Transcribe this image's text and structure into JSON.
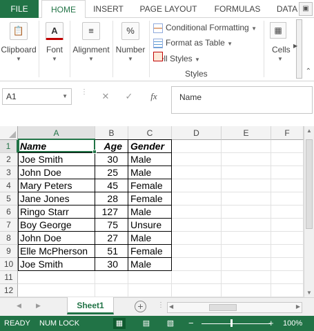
{
  "ribbon_tabs": [
    "FILE",
    "HOME",
    "INSERT",
    "PAGE LAYOUT",
    "FORMULAS",
    "DATA"
  ],
  "active_tab": "HOME",
  "ribbon": {
    "clipboard_label": "Clipboard",
    "font_label": "Font",
    "alignment_label": "Alignment",
    "number_label": "Number",
    "cells_label": "Cells",
    "styles_group_label": "Styles",
    "conditional_formatting": "Conditional Formatting",
    "format_as_table": "Format as Table",
    "cell_styles": "Cell Styles",
    "font_icon_glyph": "A",
    "number_icon_glyph": "%"
  },
  "formula_bar": {
    "name_box": "A1",
    "cancel_glyph": "✕",
    "enter_glyph": "✓",
    "fx_glyph": "fx",
    "content": "Name"
  },
  "grid": {
    "columns": [
      "A",
      "B",
      "C",
      "D",
      "E",
      "F"
    ],
    "selected_column": "A",
    "rows": [
      "1",
      "2",
      "3",
      "4",
      "5",
      "6",
      "7",
      "8",
      "9",
      "10",
      "11",
      "12"
    ],
    "selected_row": "1",
    "header": [
      "Name",
      "Age",
      "Gender"
    ],
    "data": [
      [
        "Joe Smith",
        "30",
        "Male"
      ],
      [
        "John Doe",
        "25",
        "Male"
      ],
      [
        "Mary Peters",
        "45",
        "Female"
      ],
      [
        "Jane Jones",
        "28",
        "Female"
      ],
      [
        "Ringo Starr",
        "127",
        "Male"
      ],
      [
        "Boy George",
        "75",
        "Unsure"
      ],
      [
        "John Doe",
        "27",
        "Male"
      ],
      [
        "Elle McPherson",
        "51",
        "Female"
      ],
      [
        "Joe Smith",
        "30",
        "Male"
      ]
    ]
  },
  "sheets": [
    "Sheet1"
  ],
  "add_sheet_glyph": "+",
  "status_bar": {
    "ready": "READY",
    "num_lock": "NUM LOCK",
    "zoom_minus": "−",
    "zoom_plus": "+",
    "zoom": "100%"
  },
  "colors": {
    "accent": "#217346"
  }
}
